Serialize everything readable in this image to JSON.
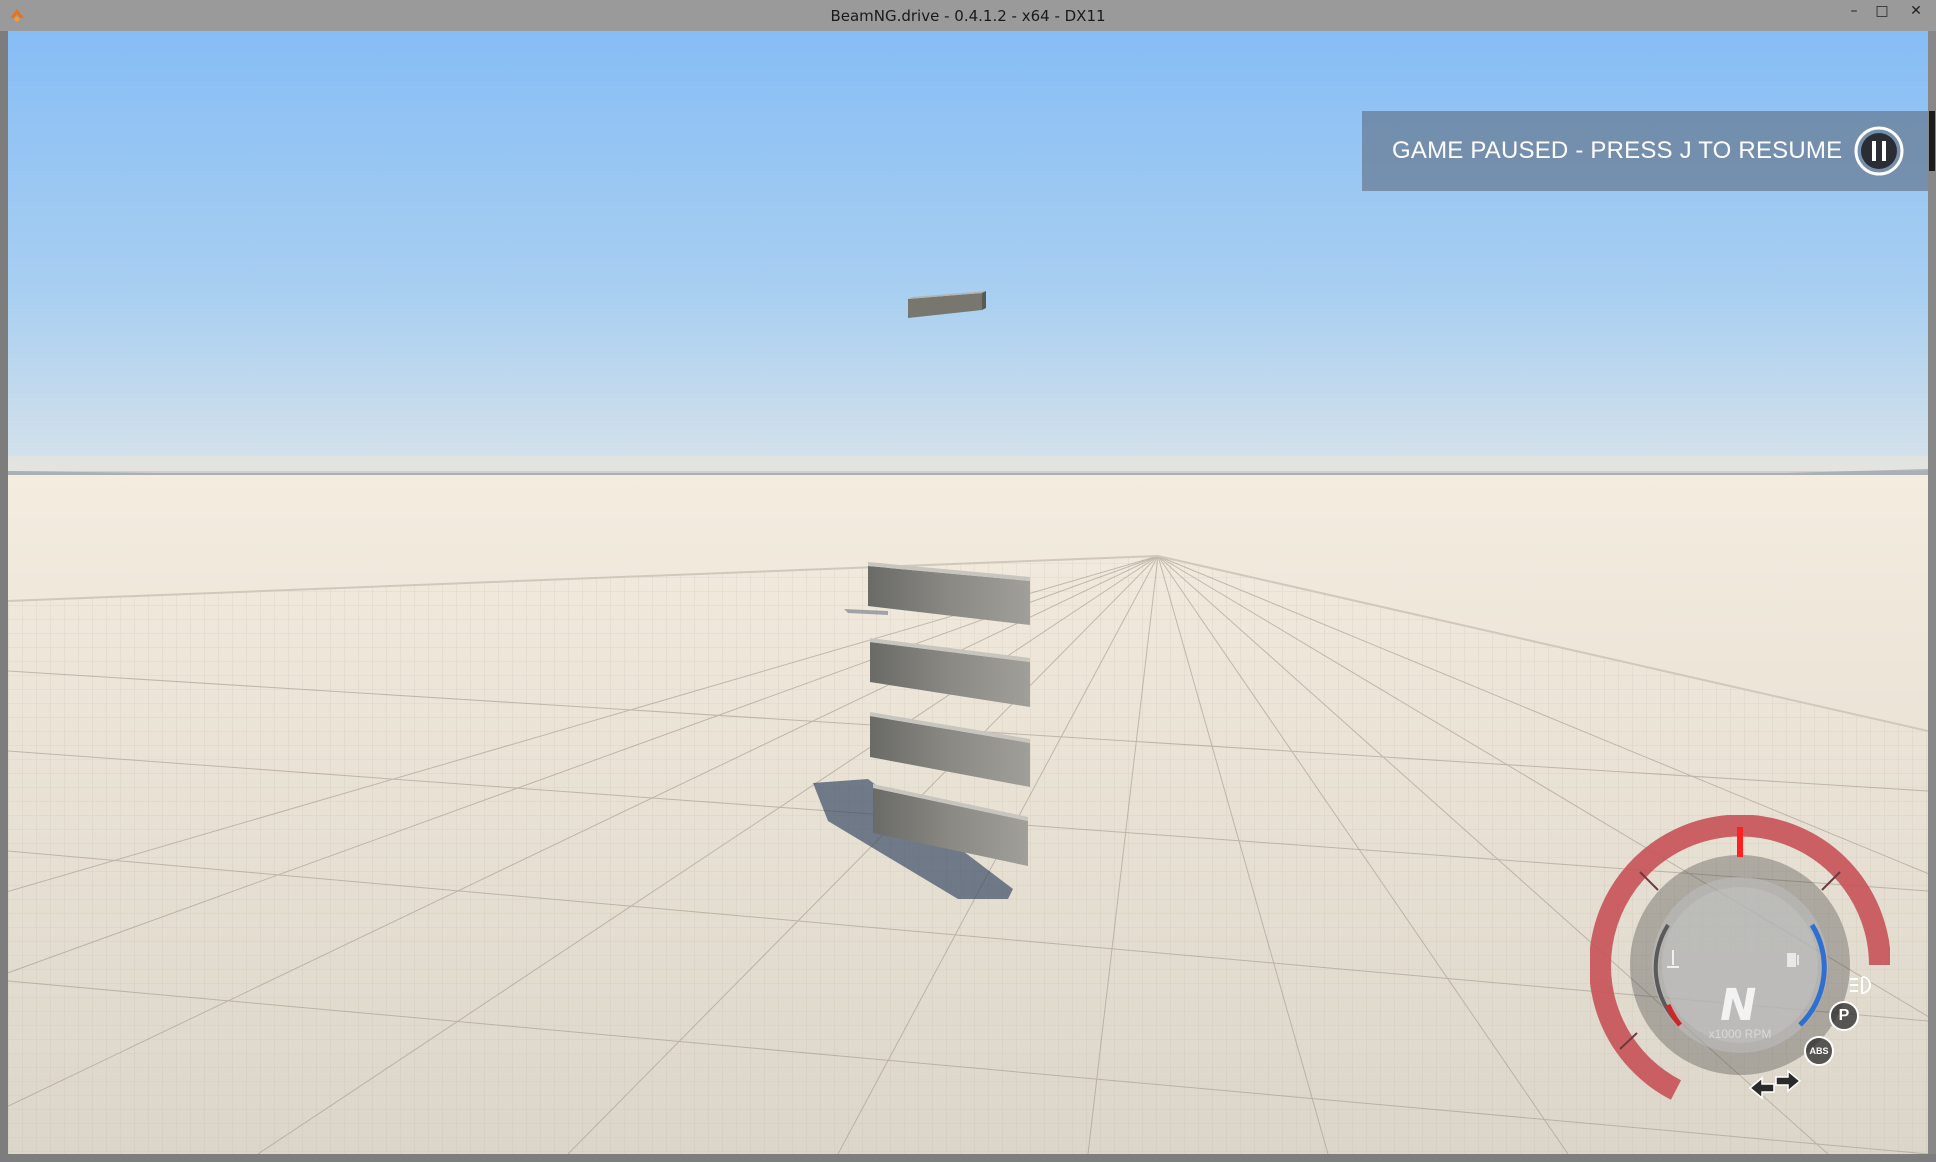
{
  "window": {
    "title": "BeamNG.drive - 0.4.1.2 - x64 - DX11",
    "minimize": "–",
    "maximize": "□",
    "close": "✕"
  },
  "hud": {
    "pause_message": "GAME PAUSED - PRESS J TO RESUME",
    "gear": "N",
    "rpm_label": "x1000 RPM",
    "abs_label": "ABS",
    "parking_label": "P"
  },
  "icons": {
    "app": "beamng-logo-icon",
    "pause": "pause-icon",
    "temperature": "thermometer-icon",
    "fuel": "fuel-pump-icon",
    "headlight": "headlight-icon",
    "turn_left": "left-arrow-icon",
    "turn_right": "right-arrow-icon"
  },
  "colors": {
    "sky_top": "#8fc2f6",
    "sky_horizon": "#d9e3ea",
    "ground": "#e7e1d5",
    "gauge_red": "#c8555a",
    "gauge_blue": "#2f6fd1"
  }
}
